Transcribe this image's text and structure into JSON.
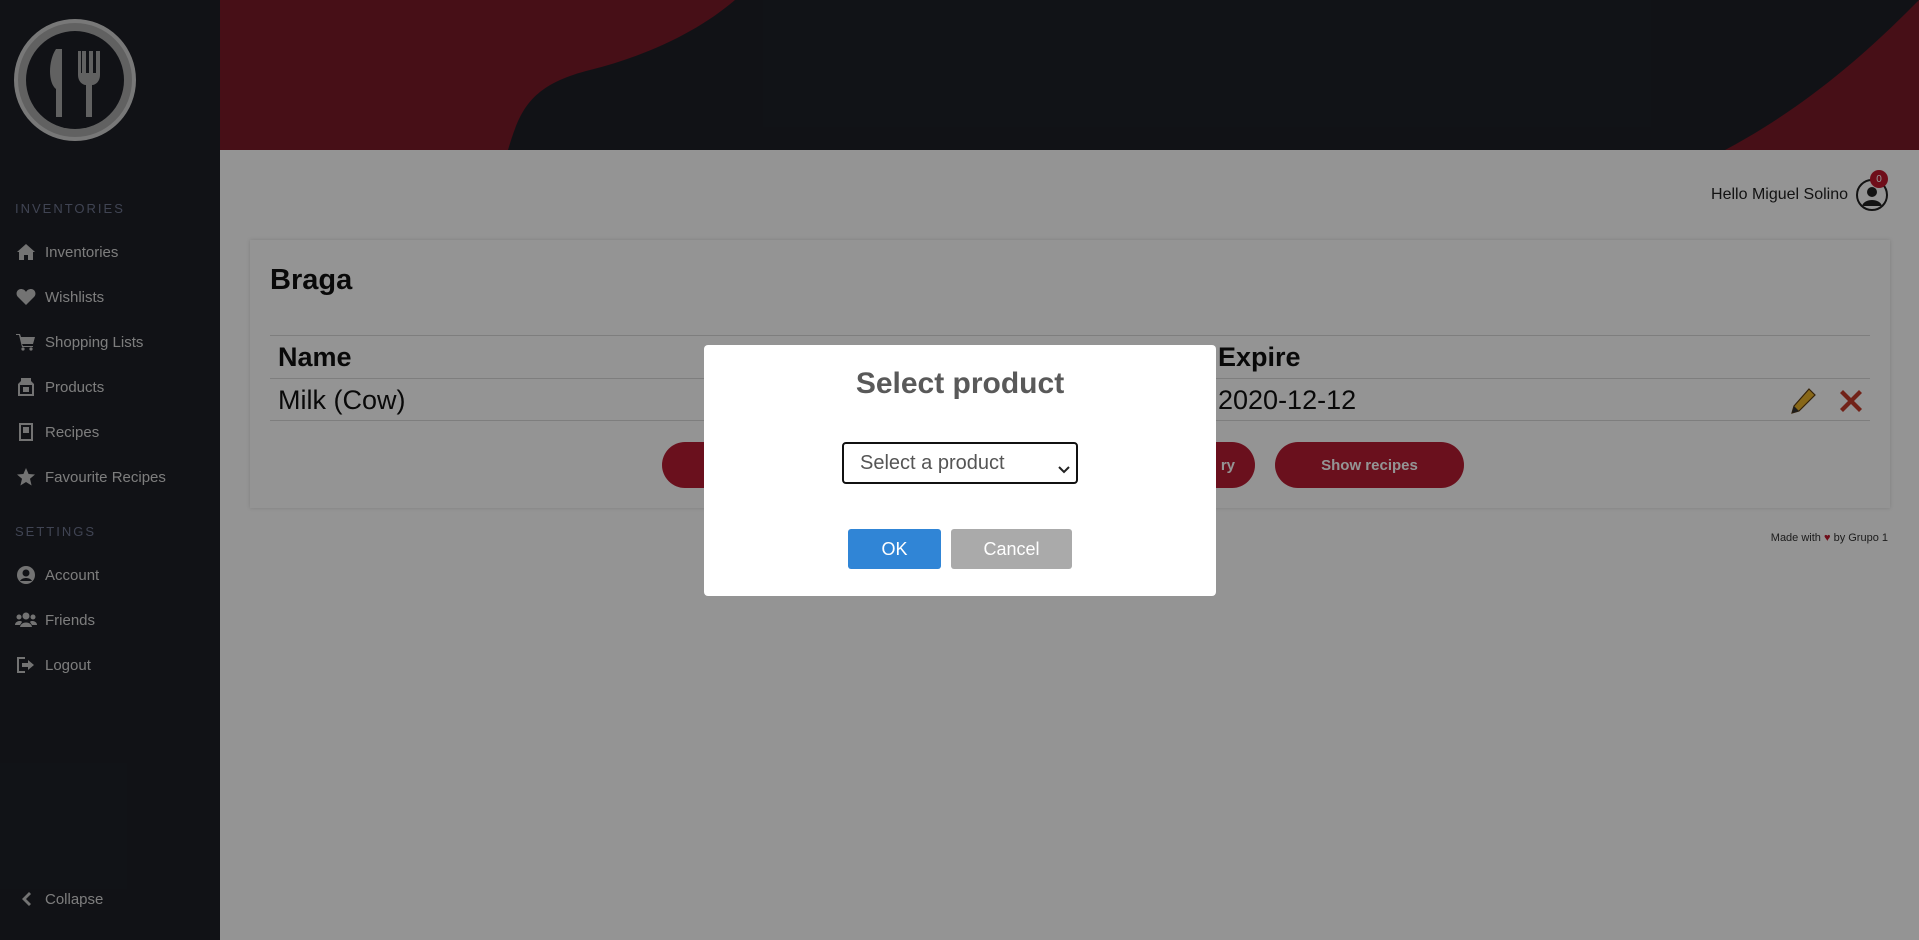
{
  "sidebar": {
    "sections": [
      {
        "title": "INVENTORIES",
        "items": [
          {
            "label": "Inventories",
            "icon": "home-icon"
          },
          {
            "label": "Wishlists",
            "icon": "heart-icon"
          },
          {
            "label": "Shopping Lists",
            "icon": "cart-icon"
          },
          {
            "label": "Products",
            "icon": "product-icon"
          },
          {
            "label": "Recipes",
            "icon": "recipe-book-icon"
          },
          {
            "label": "Favourite Recipes",
            "icon": "star-icon"
          }
        ]
      },
      {
        "title": "SETTINGS",
        "items": [
          {
            "label": "Account",
            "icon": "user-circle-icon"
          },
          {
            "label": "Friends",
            "icon": "users-icon"
          },
          {
            "label": "Logout",
            "icon": "logout-icon"
          }
        ]
      }
    ],
    "collapse_label": "Collapse"
  },
  "header": {
    "greeting": "Hello Miguel Solino",
    "notification_count": "0"
  },
  "inventory": {
    "title": "Braga",
    "columns": [
      "Name",
      "Expire"
    ],
    "rows": [
      {
        "name": "Milk (Cow)",
        "expire": "2020-12-12"
      }
    ],
    "buttons": {
      "partial_left_label": "",
      "partial_right_label": "ry",
      "show_recipes_label": "Show recipes"
    }
  },
  "footer": {
    "made_with": "Made with",
    "by": "by Grupo 1"
  },
  "dialog": {
    "title": "Select product",
    "select_placeholder": "Select a product",
    "ok_label": "OK",
    "cancel_label": "Cancel"
  },
  "colors": {
    "accent": "#b71d32",
    "sidebar_bg": "#1e2027",
    "ok_button": "#3085d6",
    "cancel_button": "#aaaaaa"
  }
}
